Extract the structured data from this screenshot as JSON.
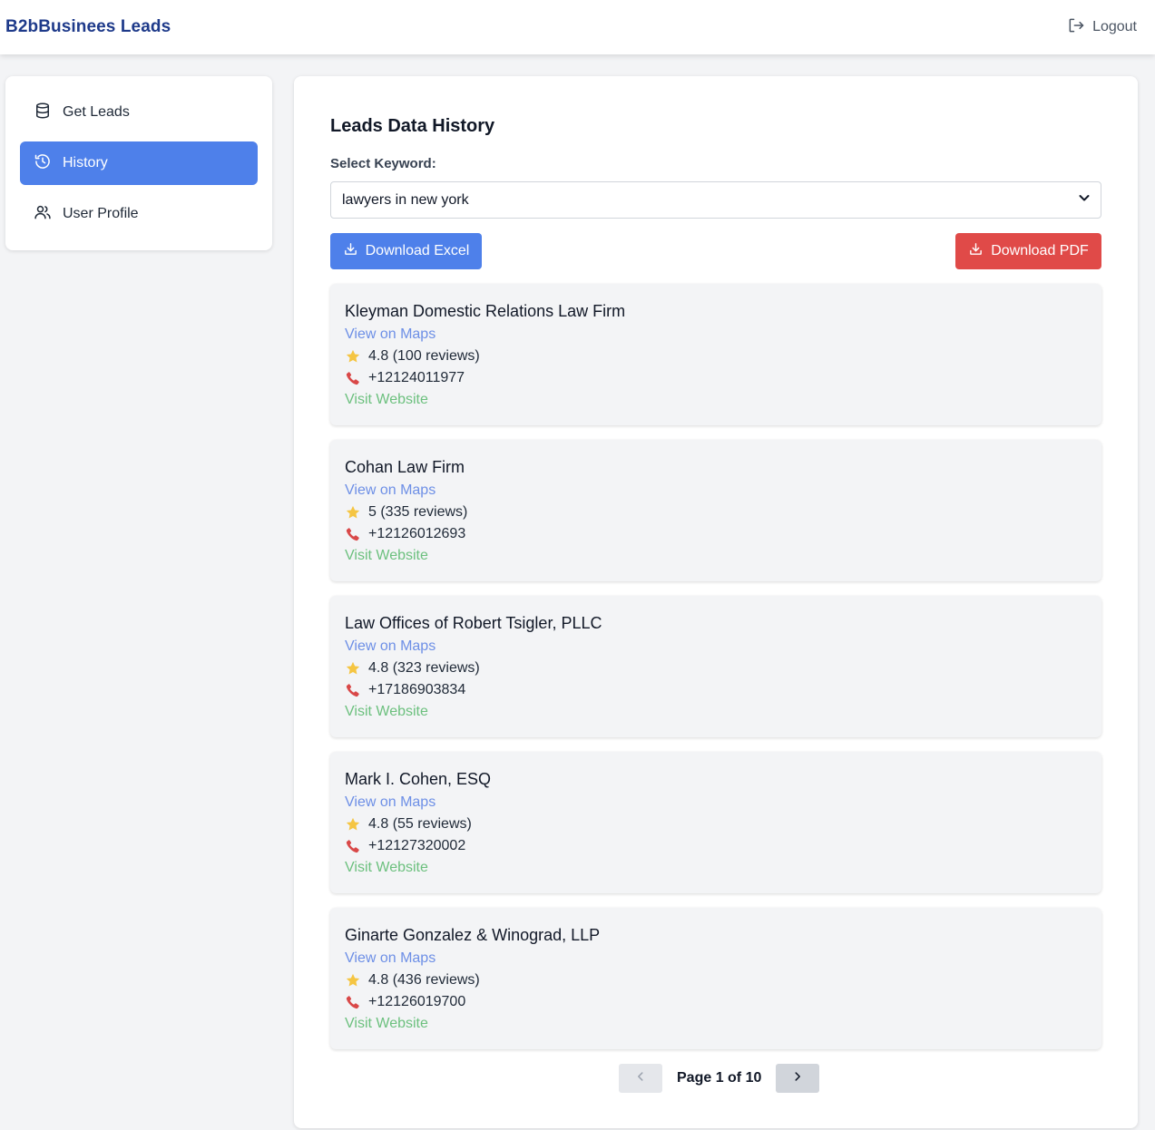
{
  "app": {
    "brand": "B2bBusinees Leads",
    "logout_label": "Logout"
  },
  "sidebar": {
    "items": [
      {
        "label": "Get Leads",
        "icon": "database-icon",
        "active": false
      },
      {
        "label": "History",
        "icon": "history-icon",
        "active": true
      },
      {
        "label": "User Profile",
        "icon": "users-icon",
        "active": false
      }
    ]
  },
  "main": {
    "title": "Leads Data History",
    "keyword_label": "Select Keyword:",
    "keyword_value": "lawyers in new york",
    "download_excel": "Download Excel",
    "download_pdf": "Download PDF"
  },
  "leads": [
    {
      "name": "Kleyman Domestic Relations Law Firm",
      "maps": "View on Maps",
      "rating": "4.8 (100 reviews)",
      "phone": "+12124011977",
      "website": "Visit Website"
    },
    {
      "name": "Cohan Law Firm",
      "maps": "View on Maps",
      "rating": "5 (335 reviews)",
      "phone": "+12126012693",
      "website": "Visit Website"
    },
    {
      "name": "Law Offices of Robert Tsigler, PLLC",
      "maps": "View on Maps",
      "rating": "4.8 (323 reviews)",
      "phone": "+17186903834",
      "website": "Visit Website"
    },
    {
      "name": "Mark I. Cohen, ESQ",
      "maps": "View on Maps",
      "rating": "4.8 (55 reviews)",
      "phone": "+12127320002",
      "website": "Visit Website"
    },
    {
      "name": "Ginarte Gonzalez & Winograd, LLP",
      "maps": "View on Maps",
      "rating": "4.8 (436 reviews)",
      "phone": "+12126019700",
      "website": "Visit Website"
    }
  ],
  "pagination": {
    "text": "Page 1 of 10"
  },
  "colors": {
    "brand": "#1e3a8a",
    "primary": "#4e80ea",
    "danger": "#e04a48",
    "maps_link": "#6d8fe6",
    "website_link": "#6cc07e",
    "star": "#f5c542",
    "phone": "#d94848"
  }
}
